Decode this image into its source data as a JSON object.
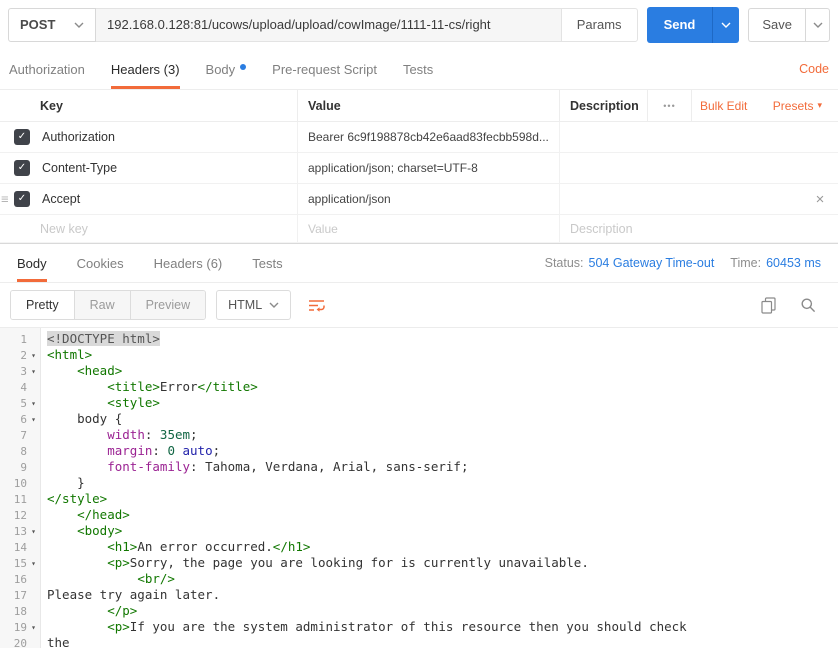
{
  "colors": {
    "accent": "#f26b3a",
    "blue": "#2a7de1",
    "checkbox": "#40434a"
  },
  "icons": {
    "check": "✓",
    "close": "×",
    "ellipsis": "•••",
    "caret_down": "▾",
    "fold_caret": "▾",
    "drag_handle": "≡"
  },
  "request_bar": {
    "method": "POST",
    "url": "192.168.0.128:81/ucows/upload/upload/cowImage/1111-11-cs/right",
    "params_label": "Params",
    "send_label": "Send",
    "save_label": "Save"
  },
  "request_tabs": {
    "items": [
      {
        "label": "Authorization"
      },
      {
        "label": "Headers (3)"
      },
      {
        "label": "Body"
      },
      {
        "label": "Pre-request Script"
      },
      {
        "label": "Tests"
      }
    ],
    "code_link": "Code"
  },
  "headers_table": {
    "columns": [
      "Key",
      "Value",
      "Description"
    ],
    "bulk_edit": "Bulk Edit",
    "presets": "Presets",
    "rows": [
      {
        "key": "Authorization",
        "value": "Bearer 6c9f198878cb42e6aad83fecbb598d...",
        "checked": true
      },
      {
        "key": "Content-Type",
        "value": "application/json; charset=UTF-8",
        "checked": true
      },
      {
        "key": "Accept",
        "value": "application/json",
        "checked": true
      }
    ],
    "new_row": {
      "key_placeholder": "New key",
      "value_placeholder": "Value",
      "description_placeholder": "Description"
    }
  },
  "response": {
    "tabs": [
      {
        "label": "Body"
      },
      {
        "label": "Cookies"
      },
      {
        "label": "Headers (6)"
      },
      {
        "label": "Tests"
      }
    ],
    "status_label": "Status:",
    "status_value": "504 Gateway Time-out",
    "time_label": "Time:",
    "time_value": "60453 ms",
    "view_modes": {
      "pretty": "Pretty",
      "raw": "Raw",
      "preview": "Preview"
    },
    "language": "HTML",
    "code": {
      "lines": [
        {
          "n": 1,
          "sel": true,
          "s": [
            {
              "c": "meta",
              "t": "<!DOCTYPE html>"
            }
          ]
        },
        {
          "n": 2,
          "fold": true,
          "s": [
            {
              "c": "tag",
              "t": "<html>"
            }
          ]
        },
        {
          "n": 3,
          "fold": true,
          "s": [
            {
              "c": "plain",
              "t": "    "
            },
            {
              "c": "tag",
              "t": "<head>"
            }
          ]
        },
        {
          "n": 4,
          "s": [
            {
              "c": "plain",
              "t": "        "
            },
            {
              "c": "tag",
              "t": "<title>"
            },
            {
              "c": "plain",
              "t": "Error"
            },
            {
              "c": "tag",
              "t": "</title>"
            }
          ]
        },
        {
          "n": 5,
          "fold": true,
          "s": [
            {
              "c": "plain",
              "t": "        "
            },
            {
              "c": "tag",
              "t": "<style>"
            }
          ]
        },
        {
          "n": 6,
          "fold": true,
          "s": [
            {
              "c": "plain",
              "t": "    body {"
            }
          ]
        },
        {
          "n": 7,
          "s": [
            {
              "c": "plain",
              "t": "        "
            },
            {
              "c": "prop",
              "t": "width"
            },
            {
              "c": "plain",
              "t": ": "
            },
            {
              "c": "num",
              "t": "35em"
            },
            {
              "c": "plain",
              "t": ";"
            }
          ]
        },
        {
          "n": 8,
          "s": [
            {
              "c": "plain",
              "t": "        "
            },
            {
              "c": "prop",
              "t": "margin"
            },
            {
              "c": "plain",
              "t": ": "
            },
            {
              "c": "num",
              "t": "0"
            },
            {
              "c": "plain",
              "t": " "
            },
            {
              "c": "atom",
              "t": "auto"
            },
            {
              "c": "plain",
              "t": ";"
            }
          ]
        },
        {
          "n": 9,
          "s": [
            {
              "c": "plain",
              "t": "        "
            },
            {
              "c": "prop",
              "t": "font-family"
            },
            {
              "c": "plain",
              "t": ": Tahoma, Verdana, Arial, sans-serif;"
            }
          ]
        },
        {
          "n": 10,
          "s": [
            {
              "c": "plain",
              "t": "    }"
            }
          ]
        },
        {
          "n": 11,
          "s": [
            {
              "c": "tag",
              "t": "</style>"
            }
          ]
        },
        {
          "n": 12,
          "s": [
            {
              "c": "plain",
              "t": "    "
            },
            {
              "c": "tag",
              "t": "</head>"
            }
          ]
        },
        {
          "n": 13,
          "fold": true,
          "s": [
            {
              "c": "plain",
              "t": "    "
            },
            {
              "c": "tag",
              "t": "<body>"
            }
          ]
        },
        {
          "n": 14,
          "s": [
            {
              "c": "plain",
              "t": "        "
            },
            {
              "c": "tag",
              "t": "<h1>"
            },
            {
              "c": "plain",
              "t": "An error occurred."
            },
            {
              "c": "tag",
              "t": "</h1>"
            }
          ]
        },
        {
          "n": 15,
          "fold": true,
          "s": [
            {
              "c": "plain",
              "t": "        "
            },
            {
              "c": "tag",
              "t": "<p>"
            },
            {
              "c": "plain",
              "t": "Sorry, the page you are looking for is currently unavailable."
            }
          ]
        },
        {
          "n": 16,
          "s": [
            {
              "c": "plain",
              "t": "            "
            },
            {
              "c": "tag",
              "t": "<br/>"
            }
          ]
        },
        {
          "n": 17,
          "s": [
            {
              "c": "plain",
              "t": "Please try again later."
            }
          ]
        },
        {
          "n": 18,
          "s": [
            {
              "c": "plain",
              "t": "        "
            },
            {
              "c": "tag",
              "t": "</p>"
            }
          ]
        },
        {
          "n": 19,
          "fold": true,
          "s": [
            {
              "c": "plain",
              "t": "        "
            },
            {
              "c": "tag",
              "t": "<p>"
            },
            {
              "c": "plain",
              "t": "If you are the system administrator of this resource then you should check"
            }
          ]
        },
        {
          "n": 20,
          "s": [
            {
              "c": "plain",
              "t": "the"
            }
          ]
        }
      ]
    }
  }
}
